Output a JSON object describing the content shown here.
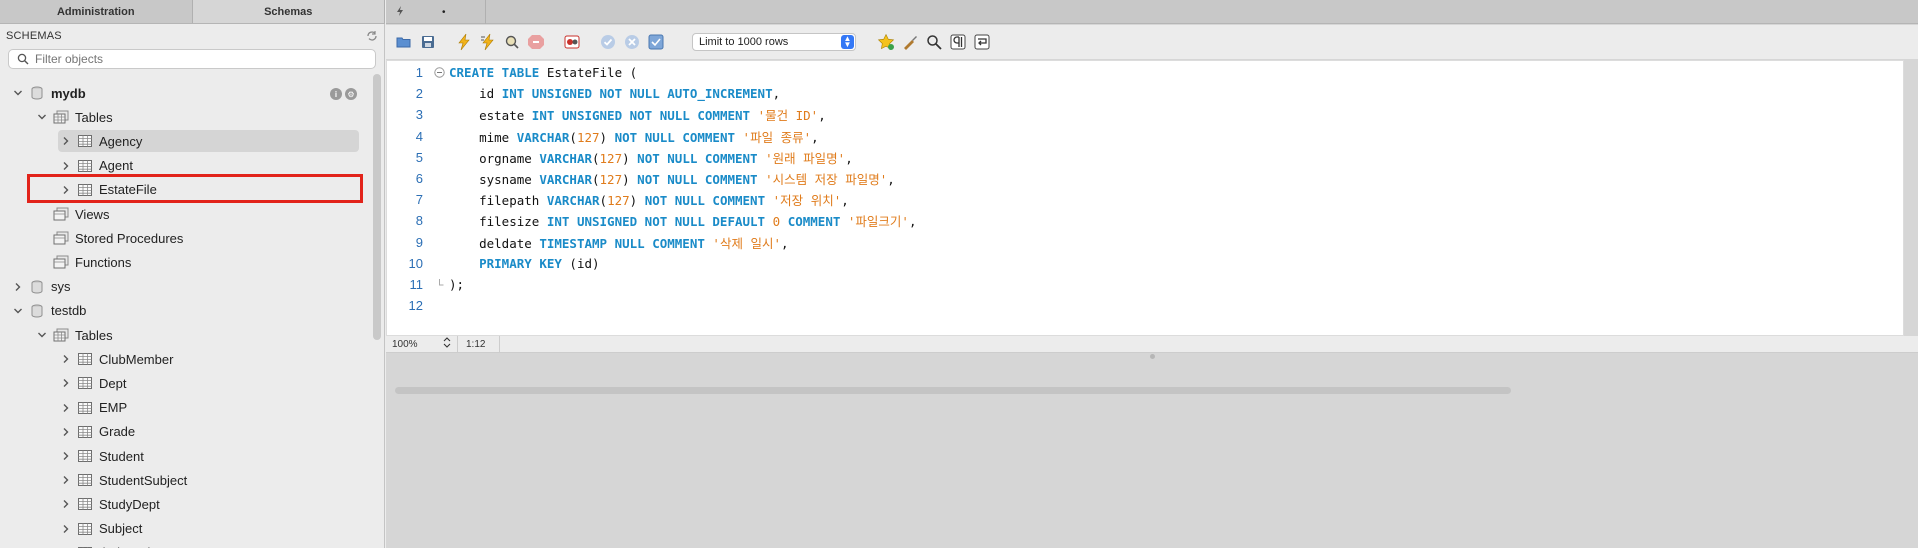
{
  "left_panel": {
    "tabs": [
      {
        "label": "Administration",
        "active": false
      },
      {
        "label": "Schemas",
        "active": true
      }
    ],
    "header": "SCHEMAS",
    "filter_placeholder": "Filter objects",
    "tree": [
      {
        "label": "mydb",
        "level": 0,
        "expanded": true,
        "icon": "database-icon",
        "bold": true
      },
      {
        "label": "Tables",
        "level": 1,
        "expanded": true,
        "icon": "tables-folder-icon"
      },
      {
        "label": "Agency",
        "level": 2,
        "expanded": false,
        "icon": "table-icon",
        "selected": true
      },
      {
        "label": "Agent",
        "level": 2,
        "expanded": false,
        "icon": "table-icon"
      },
      {
        "label": "EstateFile",
        "level": 2,
        "expanded": false,
        "icon": "table-icon",
        "highlighted": true
      },
      {
        "label": "Views",
        "level": 1,
        "expanded": null,
        "icon": "views-folder-icon"
      },
      {
        "label": "Stored Procedures",
        "level": 1,
        "expanded": null,
        "icon": "procedures-folder-icon"
      },
      {
        "label": "Functions",
        "level": 1,
        "expanded": null,
        "icon": "functions-folder-icon"
      },
      {
        "label": "sys",
        "level": 0,
        "expanded": false,
        "icon": "database-icon"
      },
      {
        "label": "testdb",
        "level": 0,
        "expanded": true,
        "icon": "database-icon"
      },
      {
        "label": "Tables",
        "level": 1,
        "expanded": true,
        "icon": "tables-folder-icon"
      },
      {
        "label": "ClubMember",
        "level": 2,
        "expanded": false,
        "icon": "table-icon"
      },
      {
        "label": "Dept",
        "level": 2,
        "expanded": false,
        "icon": "table-icon"
      },
      {
        "label": "EMP",
        "level": 2,
        "expanded": false,
        "icon": "table-icon"
      },
      {
        "label": "Grade",
        "level": 2,
        "expanded": false,
        "icon": "table-icon"
      },
      {
        "label": "Student",
        "level": 2,
        "expanded": false,
        "icon": "table-icon"
      },
      {
        "label": "StudentSubject",
        "level": 2,
        "expanded": false,
        "icon": "table-icon"
      },
      {
        "label": "StudyDept",
        "level": 2,
        "expanded": false,
        "icon": "table-icon"
      },
      {
        "label": "Subject",
        "level": 2,
        "expanded": false,
        "icon": "table-icon"
      },
      {
        "label": "tb_board",
        "level": 2,
        "expanded": false,
        "icon": "table-icon"
      }
    ]
  },
  "query_tab": {
    "modified_marker": "•"
  },
  "toolbar": {
    "limit_label": "Limit to 1000 rows",
    "icons": [
      "open-file-icon",
      "save-icon",
      "execute-icon",
      "execute-current-icon",
      "explain-icon",
      "stop-icon",
      "toggle-error-stop-icon",
      "commit-icon",
      "rollback-icon",
      "autocommit-icon",
      "add-snippet-icon",
      "beautify-icon",
      "find-icon",
      "invisible-chars-icon",
      "wrap-lines-icon"
    ]
  },
  "editor": {
    "lines": [
      [
        {
          "t": "CREATE TABLE",
          "c": "kw"
        },
        {
          "t": " EstateFile (",
          "c": ""
        }
      ],
      [
        {
          "t": "    id ",
          "c": ""
        },
        {
          "t": "INT UNSIGNED NOT NULL AUTO_INCREMENT",
          "c": "kw"
        },
        {
          "t": ",",
          "c": ""
        }
      ],
      [
        {
          "t": "    estate ",
          "c": ""
        },
        {
          "t": "INT UNSIGNED NOT NULL COMMENT",
          "c": "kw"
        },
        {
          "t": " ",
          "c": ""
        },
        {
          "t": "'물건 ID'",
          "c": "str"
        },
        {
          "t": ",",
          "c": ""
        }
      ],
      [
        {
          "t": "    mime ",
          "c": ""
        },
        {
          "t": "VARCHAR",
          "c": "kw"
        },
        {
          "t": "(",
          "c": ""
        },
        {
          "t": "127",
          "c": "num"
        },
        {
          "t": ") ",
          "c": ""
        },
        {
          "t": "NOT NULL COMMENT",
          "c": "kw"
        },
        {
          "t": " ",
          "c": ""
        },
        {
          "t": "'파일 종류'",
          "c": "str"
        },
        {
          "t": ",",
          "c": ""
        }
      ],
      [
        {
          "t": "    orgname ",
          "c": ""
        },
        {
          "t": "VARCHAR",
          "c": "kw"
        },
        {
          "t": "(",
          "c": ""
        },
        {
          "t": "127",
          "c": "num"
        },
        {
          "t": ") ",
          "c": ""
        },
        {
          "t": "NOT NULL COMMENT",
          "c": "kw"
        },
        {
          "t": " ",
          "c": ""
        },
        {
          "t": "'원래 파일명'",
          "c": "str"
        },
        {
          "t": ",",
          "c": ""
        }
      ],
      [
        {
          "t": "    sysname ",
          "c": ""
        },
        {
          "t": "VARCHAR",
          "c": "kw"
        },
        {
          "t": "(",
          "c": ""
        },
        {
          "t": "127",
          "c": "num"
        },
        {
          "t": ") ",
          "c": ""
        },
        {
          "t": "NOT NULL COMMENT",
          "c": "kw"
        },
        {
          "t": " ",
          "c": ""
        },
        {
          "t": "'시스템 저장 파일명'",
          "c": "str"
        },
        {
          "t": ",",
          "c": ""
        }
      ],
      [
        {
          "t": "    filepath ",
          "c": ""
        },
        {
          "t": "VARCHAR",
          "c": "kw"
        },
        {
          "t": "(",
          "c": ""
        },
        {
          "t": "127",
          "c": "num"
        },
        {
          "t": ") ",
          "c": ""
        },
        {
          "t": "NOT NULL COMMENT",
          "c": "kw"
        },
        {
          "t": " ",
          "c": ""
        },
        {
          "t": "'저장 위치'",
          "c": "str"
        },
        {
          "t": ",",
          "c": ""
        }
      ],
      [
        {
          "t": "    filesize ",
          "c": ""
        },
        {
          "t": "INT UNSIGNED NOT NULL DEFAULT",
          "c": "kw"
        },
        {
          "t": " ",
          "c": ""
        },
        {
          "t": "0",
          "c": "num"
        },
        {
          "t": " ",
          "c": ""
        },
        {
          "t": "COMMENT",
          "c": "kw"
        },
        {
          "t": " ",
          "c": ""
        },
        {
          "t": "'파일크기'",
          "c": "str"
        },
        {
          "t": ",",
          "c": ""
        }
      ],
      [
        {
          "t": "    deldate ",
          "c": ""
        },
        {
          "t": "TIMESTAMP NULL COMMENT",
          "c": "kw"
        },
        {
          "t": " ",
          "c": ""
        },
        {
          "t": "'삭제 일시'",
          "c": "str"
        },
        {
          "t": ",",
          "c": ""
        }
      ],
      [
        {
          "t": "    ",
          "c": ""
        },
        {
          "t": "PRIMARY KEY",
          "c": "kw"
        },
        {
          "t": " (id)",
          "c": ""
        }
      ],
      [
        {
          "t": ");",
          "c": ""
        }
      ],
      []
    ]
  },
  "statusbar": {
    "zoom": "100%",
    "cursor": "1:12"
  }
}
